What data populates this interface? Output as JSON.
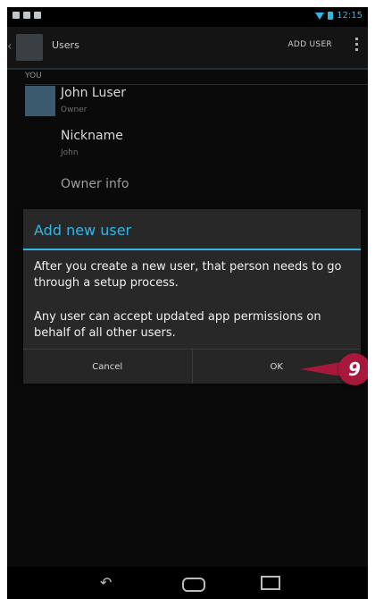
{
  "status_bar": {
    "time": "12:15"
  },
  "action_bar": {
    "title": "Users",
    "add_user_label": "ADD USER"
  },
  "users": {
    "section_label": "YOU",
    "owner": {
      "name": "John Luser",
      "role": "Owner"
    },
    "nickname": {
      "label": "Nickname",
      "value": "John"
    },
    "owner_info_label": "Owner info"
  },
  "dialog": {
    "title": "Add new user",
    "message_1": "After you create a new user, that person needs to go through a setup process.",
    "message_2": "Any user can accept updated app permissions on behalf of all other users.",
    "cancel_label": "Cancel",
    "ok_label": "OK"
  },
  "callout": {
    "step": "9",
    "color": "#a8183a"
  },
  "colors": {
    "accent": "#33b5e5",
    "background": "#0a0a0a",
    "dialog": "#282828"
  },
  "icons": [
    "wifi-icon",
    "battery-icon",
    "overflow-menu-icon",
    "back-nav-icon",
    "home-nav-icon",
    "recents-nav-icon"
  ]
}
